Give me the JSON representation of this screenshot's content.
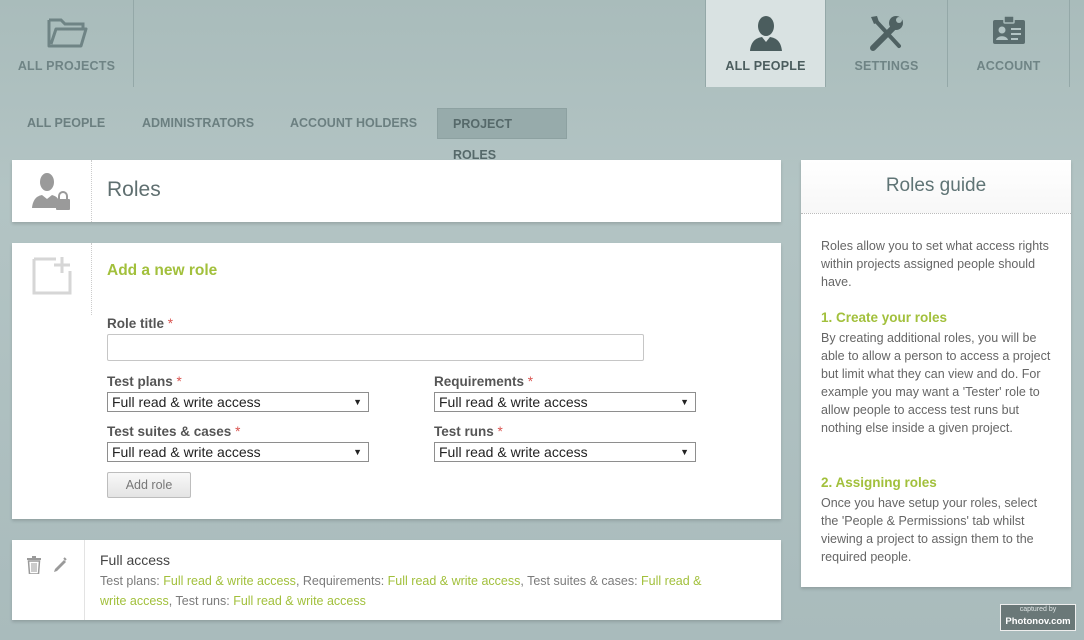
{
  "topnav": {
    "all_projects": "ALL PROJECTS",
    "all_people": "ALL PEOPLE",
    "settings": "SETTINGS",
    "account": "ACCOUNT",
    "active": "all_people"
  },
  "subnav": {
    "all_people": "ALL PEOPLE",
    "administrators": "ADMINISTRATORS",
    "account_holders": "ACCOUNT HOLDERS",
    "project_roles": "PROJECT ROLES",
    "active": "project_roles"
  },
  "header": {
    "title": "Roles"
  },
  "add_role": {
    "title": "Add a new role",
    "role_title_label": "Role title",
    "required_mark": "*",
    "role_title_value": "",
    "test_plans_label": "Test plans",
    "test_plans_value": "Full read & write access",
    "requirements_label": "Requirements",
    "requirements_value": "Full read & write access",
    "test_suites_label": "Test suites & cases",
    "test_suites_value": "Full read & write access",
    "test_runs_label": "Test runs",
    "test_runs_value": "Full read & write access",
    "button_label": "Add role"
  },
  "roles": [
    {
      "name": "Full access",
      "test_plans_key": "Test plans:",
      "test_plans_val": "Full read & write access",
      "requirements_key": "Requirements:",
      "requirements_val": "Full read & write access",
      "test_suites_key": "Test suites & cases:",
      "test_suites_val": "Full read & write access",
      "test_runs_key": "Test runs:",
      "test_runs_val": "Full read & write access"
    }
  ],
  "guide": {
    "title": "Roles guide",
    "intro": "Roles allow you to set what access rights within projects assigned people should have.",
    "step1_title": "1. Create your roles",
    "step1_text": "By creating additional roles, you will be able to allow a person to access a project but limit what they can view and do. For example you may want a 'Tester' role to allow people to access test runs but nothing else inside a given project.",
    "step2_title": "2. Assigning roles",
    "step2_text": "Once you have setup your roles, select the 'People & Permissions' tab whilst viewing a project to assign them to the required people."
  },
  "watermark": {
    "line1": "captured by",
    "line2": "Photonov.com"
  },
  "colors": {
    "accent": "#a2c03c",
    "background": "#adbfbf",
    "required": "#d9534f"
  }
}
